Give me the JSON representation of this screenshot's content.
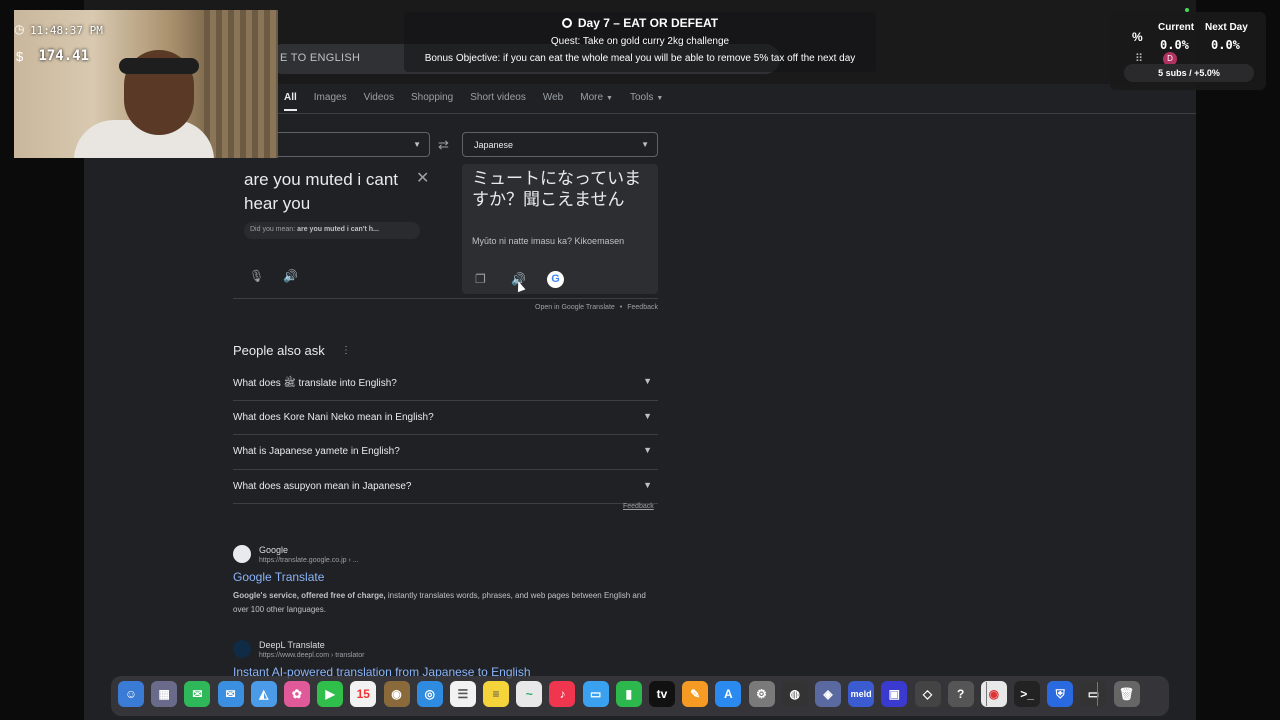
{
  "search": {
    "query_visible": "E TO ENGLISH"
  },
  "tabs": [
    {
      "label": "All",
      "active": true
    },
    {
      "label": "Images"
    },
    {
      "label": "Videos"
    },
    {
      "label": "Shopping"
    },
    {
      "label": "Short videos"
    },
    {
      "label": "Web"
    },
    {
      "label": "More"
    },
    {
      "label": "Tools"
    }
  ],
  "translate": {
    "target_lang": "Japanese",
    "source_text": "are you muted i cant hear you",
    "did_you_mean_prefix": "Did you mean:",
    "did_you_mean_value": "are you muted i can't h...",
    "target_text": "ミュートになっていますか？聞こえません",
    "romanization": "Myūto ni natte imasu ka? Kikoemasen",
    "open_link": "Open in Google Translate",
    "feedback": "Feedback"
  },
  "paa": {
    "title": "People also ask",
    "questions": [
      "What does ﷺ translate into English?",
      "What does Kore Nani Neko mean in English?",
      "What is Japanese yamete in English?",
      "What does asupyon mean in Japanese?"
    ],
    "feedback": "Feedback"
  },
  "results": [
    {
      "site": "Google",
      "url": "https://translate.google.co.jp › ...",
      "title": "Google Translate",
      "snippet_bold": "Google's service, offered free of charge,",
      "snippet": " instantly translates words, phrases, and web pages between English and over 100 other languages."
    },
    {
      "site": "DeepL Translate",
      "url": "https://www.deepl.com › translator",
      "title": "Instant AI-powered translation from Japanese to English"
    }
  ],
  "hud": {
    "time": "11:48:37 PM",
    "money": "$174.41",
    "currency_symbol": "$"
  },
  "quest": {
    "day": "Day 7 – EAT OR DEFEAT",
    "quest": "Quest: Take on gold curry 2kg challenge",
    "bonus": "Bonus Objective: if you can eat the whole meal you will be able to remove 5% tax off the next day"
  },
  "stats": {
    "current_label": "Current",
    "current_value": "0.0%",
    "next_label": "Next Day",
    "next_value": "0.0%",
    "avatar_letter": "D",
    "subs": "5 subs / +5.0%"
  },
  "colors": {
    "link": "#8ab4f8",
    "bg": "#202124",
    "accent_green": "#3fdc5a"
  }
}
